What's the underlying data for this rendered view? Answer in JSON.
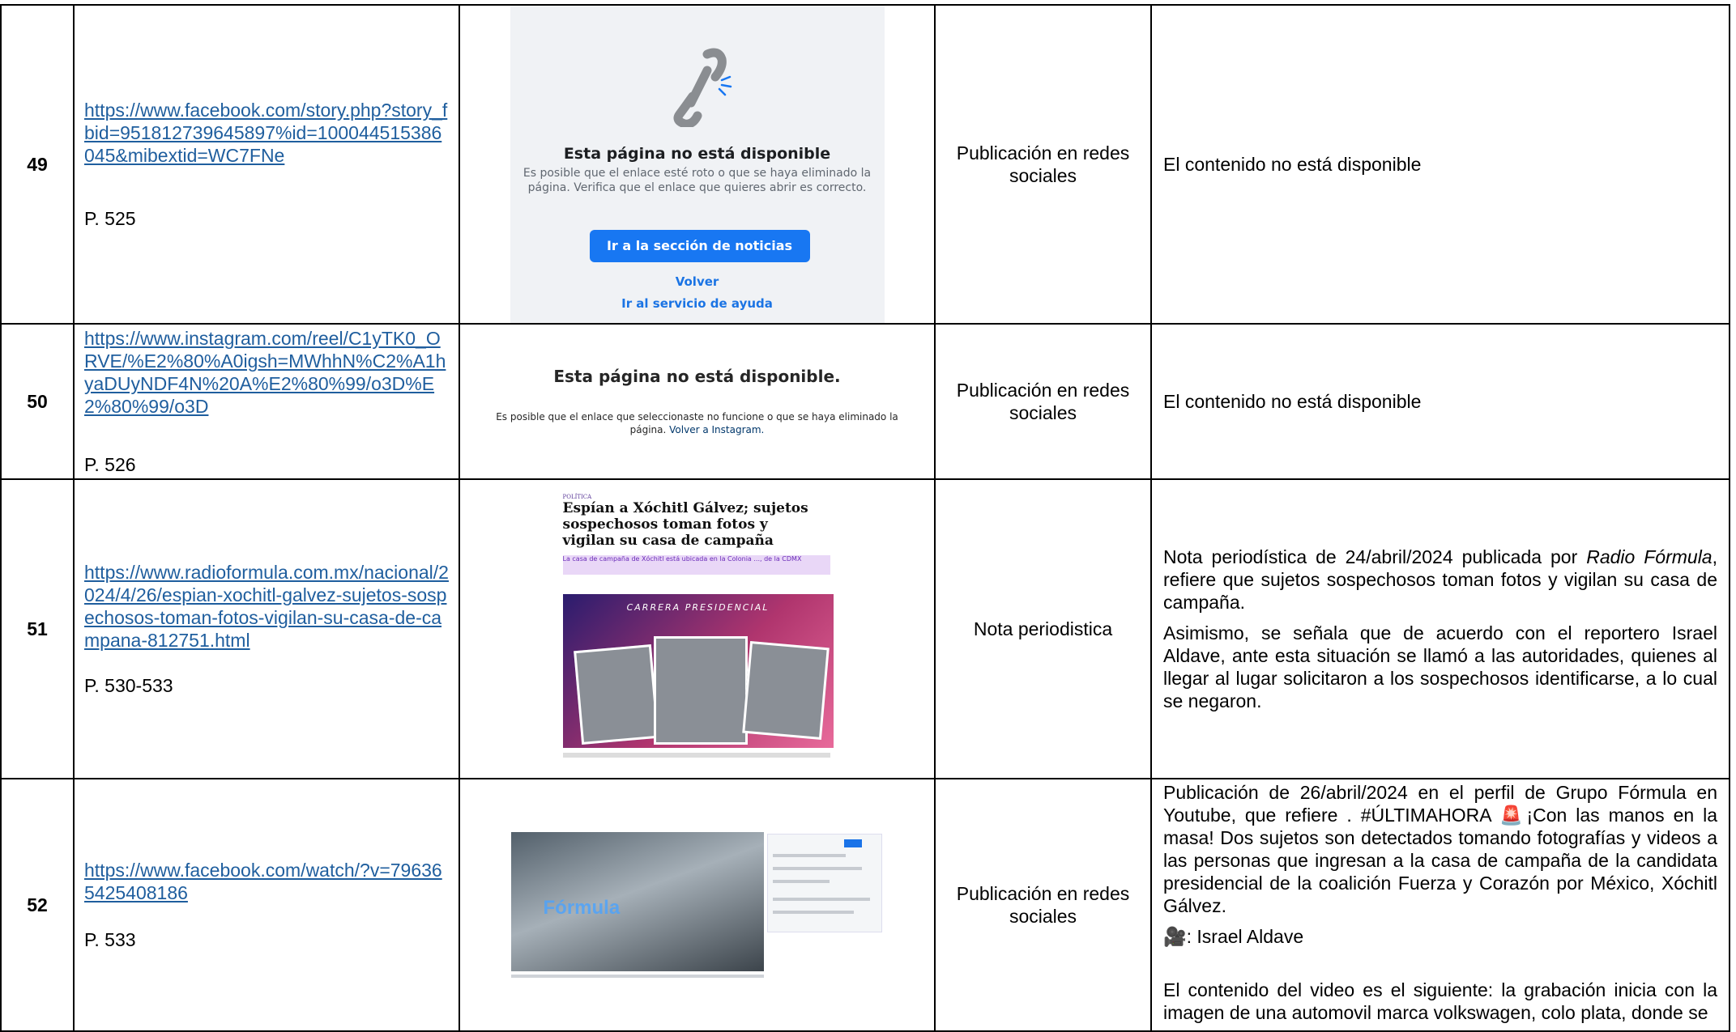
{
  "rows": [
    {
      "num": "49",
      "url": "https://www.facebook.com/story.php?story_fbid=951812739645897%id=100044515386045&mibextid=WC7FNe",
      "page": "P. 525",
      "screenshot": {
        "title": "Esta página no está disponible",
        "text": "Es posible que el enlace esté roto o que se haya eliminado la página. Verifica que el enlace que quieres abrir es correcto.",
        "button": "Ir a la sección de noticias",
        "back": "Volver",
        "help": "Ir al servicio de ayuda"
      },
      "type": "Publicación en redes sociales",
      "description": "El contenido no está disponible"
    },
    {
      "num": "50",
      "url": "https://www.instagram.com/reel/C1yTK0_ORVE/%E2%80%A0igsh=MWhhN%C2%A1hyaDUyNDF4N%20A%E2%80%99/o3D%E2%80%99/o3D",
      "page": "P. 526",
      "screenshot": {
        "title": "Esta página no está disponible.",
        "text": "Es posible que el enlace que seleccionaste no funcione o que se haya eliminado la página.",
        "link": "Volver a Instagram."
      },
      "type": "Publicación en redes sociales",
      "description": "El contenido no está disponible"
    },
    {
      "num": "51",
      "url": "https://www.radioformula.com.mx/nacional/2024/4/26/espian-xochitl-galvez-sujetos-sospechosos-toman-fotos-vigilan-su-casa-de-campana-812751.html",
      "page": "P. 530-533",
      "screenshot": {
        "tag": "POLÍTICA",
        "headline": "Espían a Xóchitl Gálvez; sujetos sospechosos toman fotos y vigilan su casa de campaña",
        "subhead": "La casa de campaña de Xóchitl está ubicada en la Colonia ..., de la CDMX",
        "banner": "CARRERA PRESIDENCIAL"
      },
      "type": "Nota periodistica",
      "description_p1_a": "Nota periodística de 24/abril/2024 publicada por ",
      "description_p1_b": "Radio Fórmula",
      "description_p1_c": ", refiere que  sujetos sospechosos toman fotos y vigilan su casa de campaña.",
      "description_p2": "Asimismo, se señala que de acuerdo con el reportero Israel Aldave, ante esta situación se llamó a las autoridades, quienes al llegar al lugar solicitaron a los sospechosos identificarse, a lo cual se negaron."
    },
    {
      "num": "52",
      "url": "https://www.facebook.com/watch/?v=796365425408186",
      "page": "P. 533",
      "screenshot": {
        "logo": "Fórmula"
      },
      "type": "Publicación en redes sociales",
      "description_p1": "Publicación de 26/abril/2024 en el perfil de Grupo Fórmula en Youtube, que refiere . #ÚLTIMAHORA 🚨¡Con las manos en la masa! Dos sujetos son detectados tomando fotografías y videos a las personas que ingresan a la casa de campaña de la candidata presidencial de la coalición Fuerza y Corazón por México, Xóchitl Gálvez.",
      "description_p2": "🎥: Israel Aldave",
      "description_p3": "El contenido del video es el siguiente: la grabación inicia con la imagen de una automovil marca volkswagen, colo plata, donde se"
    }
  ]
}
